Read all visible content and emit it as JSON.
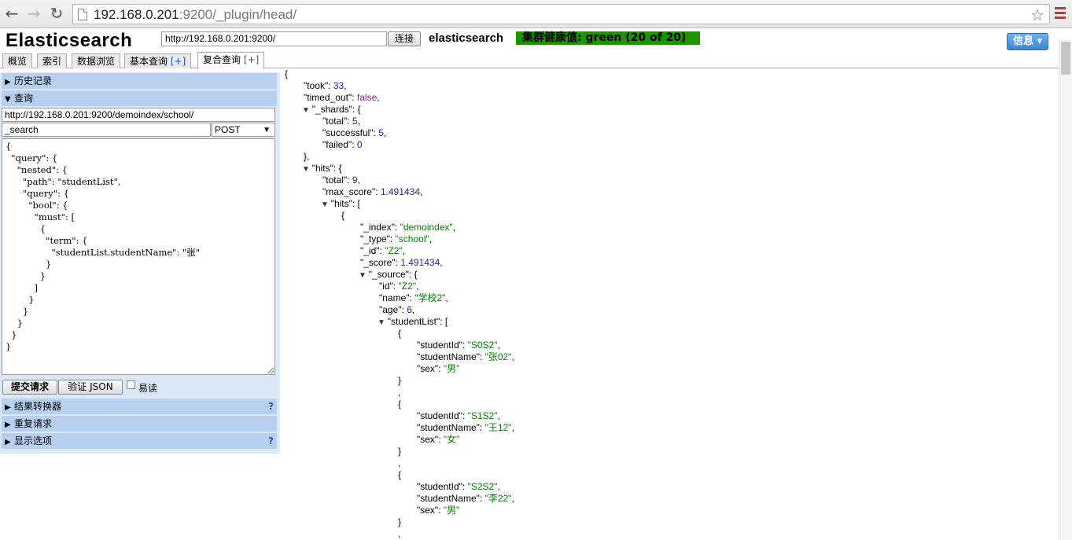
{
  "browser": {
    "url_host": "192.168.0.201",
    "url_rest": ":9200/_plugin/head/",
    "back_icon": "arrow-left-icon",
    "forward_icon": "arrow-right-icon",
    "reload_icon": "reload-icon",
    "star_icon": "star-icon",
    "menu_icon": "hamburger-menu-icon"
  },
  "header": {
    "title": "Elasticsearch",
    "connection_url": "http://192.168.0.201:9200/",
    "connect_label": "连接",
    "cluster_name": "elasticsearch",
    "health_label": "集群健康值: green (20 of 20)",
    "health_color": "#1f9200",
    "info_label": "信息 ▾"
  },
  "tabs": [
    {
      "label": "概览"
    },
    {
      "label": "索引"
    },
    {
      "label": "数据浏览"
    },
    {
      "label": "基本查询",
      "plus": "[+]"
    },
    {
      "label": "复合查询",
      "plus": "[+]"
    }
  ],
  "left": {
    "history_label": "历史记录",
    "query_label": "查询",
    "query_url": "http://192.168.0.201:9200/demoindex/school/",
    "query_path": "_search",
    "method": "POST",
    "query_body": "{\n  \"query\": {\n    \"nested\": {\n      \"path\": \"studentList\",\n      \"query\": {\n        \"bool\": {\n          \"must\": [\n            {\n              \"term\": {\n                \"studentList.studentName\": \"张\"\n              }\n            }\n          ]\n        }\n      }\n    }\n  }\n}",
    "submit_label": "提交请求",
    "validate_label": "验证 JSON",
    "easy_read_label": "易读",
    "transformer_label": "结果转换器",
    "repeat_label": "重复请求",
    "display_label": "显示选项",
    "help_mark": "?"
  },
  "json_lines": [
    {
      "i": 0,
      "t": "",
      "p": [
        [
          "k",
          "{"
        ]
      ]
    },
    {
      "i": 1,
      "t": "",
      "p": [
        [
          "k",
          "\"took\": "
        ],
        [
          "n",
          "33"
        ],
        [
          "k",
          ","
        ]
      ]
    },
    {
      "i": 1,
      "t": "",
      "p": [
        [
          "k",
          "\"timed_out\": "
        ],
        [
          "b",
          "false"
        ],
        [
          "k",
          ","
        ]
      ]
    },
    {
      "i": 1,
      "t": "▼",
      "p": [
        [
          "k",
          "\"_shards\": {"
        ]
      ]
    },
    {
      "i": 2,
      "t": "",
      "p": [
        [
          "k",
          "\"total\": "
        ],
        [
          "n",
          "5"
        ],
        [
          "k",
          ","
        ]
      ]
    },
    {
      "i": 2,
      "t": "",
      "p": [
        [
          "k",
          "\"successful\": "
        ],
        [
          "n",
          "5"
        ],
        [
          "k",
          ","
        ]
      ]
    },
    {
      "i": 2,
      "t": "",
      "p": [
        [
          "k",
          "\"failed\": "
        ],
        [
          "n",
          "0"
        ]
      ]
    },
    {
      "i": 1,
      "t": "",
      "p": [
        [
          "k",
          "},"
        ]
      ]
    },
    {
      "i": 1,
      "t": "▼",
      "p": [
        [
          "k",
          "\"hits\": {"
        ]
      ]
    },
    {
      "i": 2,
      "t": "",
      "p": [
        [
          "k",
          "\"total\": "
        ],
        [
          "n",
          "9"
        ],
        [
          "k",
          ","
        ]
      ]
    },
    {
      "i": 2,
      "t": "",
      "p": [
        [
          "k",
          "\"max_score\": "
        ],
        [
          "n",
          "1.491434"
        ],
        [
          "k",
          ","
        ]
      ]
    },
    {
      "i": 2,
      "t": "▼",
      "p": [
        [
          "k",
          "\"hits\": ["
        ]
      ]
    },
    {
      "i": 3,
      "t": "",
      "p": [
        [
          "k",
          "{"
        ]
      ]
    },
    {
      "i": 4,
      "t": "",
      "p": [
        [
          "k",
          "\"_index\": "
        ],
        [
          "s",
          "\"demoindex\""
        ],
        [
          "k",
          ","
        ]
      ]
    },
    {
      "i": 4,
      "t": "",
      "p": [
        [
          "k",
          "\"_type\": "
        ],
        [
          "s",
          "\"school\""
        ],
        [
          "k",
          ","
        ]
      ]
    },
    {
      "i": 4,
      "t": "",
      "p": [
        [
          "k",
          "\"_id\": "
        ],
        [
          "s",
          "\"Z2\""
        ],
        [
          "k",
          ","
        ]
      ]
    },
    {
      "i": 4,
      "t": "",
      "p": [
        [
          "k",
          "\"_score\": "
        ],
        [
          "n",
          "1.491434"
        ],
        [
          "k",
          ","
        ]
      ]
    },
    {
      "i": 4,
      "t": "▼",
      "p": [
        [
          "k",
          "\"_source\": {"
        ]
      ]
    },
    {
      "i": 5,
      "t": "",
      "p": [
        [
          "k",
          "\"id\": "
        ],
        [
          "s",
          "\"Z2\""
        ],
        [
          "k",
          ","
        ]
      ]
    },
    {
      "i": 5,
      "t": "",
      "p": [
        [
          "k",
          "\"name\": "
        ],
        [
          "s",
          "\"学校2\""
        ],
        [
          "k",
          ","
        ]
      ]
    },
    {
      "i": 5,
      "t": "",
      "p": [
        [
          "k",
          "\"age\": "
        ],
        [
          "n",
          "6"
        ],
        [
          "k",
          ","
        ]
      ]
    },
    {
      "i": 5,
      "t": "▼",
      "p": [
        [
          "k",
          "\"studentList\": ["
        ]
      ]
    },
    {
      "i": 6,
      "t": "",
      "p": [
        [
          "k",
          "{"
        ]
      ]
    },
    {
      "i": 7,
      "t": "",
      "p": [
        [
          "k",
          "\"studentId\": "
        ],
        [
          "s",
          "\"S0S2\""
        ],
        [
          "k",
          ","
        ]
      ]
    },
    {
      "i": 7,
      "t": "",
      "p": [
        [
          "k",
          "\"studentName\": "
        ],
        [
          "s",
          "\"张02\""
        ],
        [
          "k",
          ","
        ]
      ]
    },
    {
      "i": 7,
      "t": "",
      "p": [
        [
          "k",
          "\"sex\": "
        ],
        [
          "s",
          "\"男\""
        ]
      ]
    },
    {
      "i": 6,
      "t": "",
      "p": [
        [
          "k",
          "}"
        ]
      ]
    },
    {
      "i": 6,
      "t": "",
      "p": [
        [
          "k",
          ","
        ]
      ]
    },
    {
      "i": 6,
      "t": "",
      "p": [
        [
          "k",
          "{"
        ]
      ]
    },
    {
      "i": 7,
      "t": "",
      "p": [
        [
          "k",
          "\"studentId\": "
        ],
        [
          "s",
          "\"S1S2\""
        ],
        [
          "k",
          ","
        ]
      ]
    },
    {
      "i": 7,
      "t": "",
      "p": [
        [
          "k",
          "\"studentName\": "
        ],
        [
          "s",
          "\"王12\""
        ],
        [
          "k",
          ","
        ]
      ]
    },
    {
      "i": 7,
      "t": "",
      "p": [
        [
          "k",
          "\"sex\": "
        ],
        [
          "s",
          "\"女\""
        ]
      ]
    },
    {
      "i": 6,
      "t": "",
      "p": [
        [
          "k",
          "}"
        ]
      ]
    },
    {
      "i": 6,
      "t": "",
      "p": [
        [
          "k",
          ","
        ]
      ]
    },
    {
      "i": 6,
      "t": "",
      "p": [
        [
          "k",
          "{"
        ]
      ]
    },
    {
      "i": 7,
      "t": "",
      "p": [
        [
          "k",
          "\"studentId\": "
        ],
        [
          "s",
          "\"S2S2\""
        ],
        [
          "k",
          ","
        ]
      ]
    },
    {
      "i": 7,
      "t": "",
      "p": [
        [
          "k",
          "\"studentName\": "
        ],
        [
          "s",
          "\"李22\""
        ],
        [
          "k",
          ","
        ]
      ]
    },
    {
      "i": 7,
      "t": "",
      "p": [
        [
          "k",
          "\"sex\": "
        ],
        [
          "s",
          "\"男\""
        ]
      ]
    },
    {
      "i": 6,
      "t": "",
      "p": [
        [
          "k",
          "}"
        ]
      ]
    },
    {
      "i": 6,
      "t": "",
      "p": [
        [
          "k",
          ","
        ]
      ]
    }
  ]
}
